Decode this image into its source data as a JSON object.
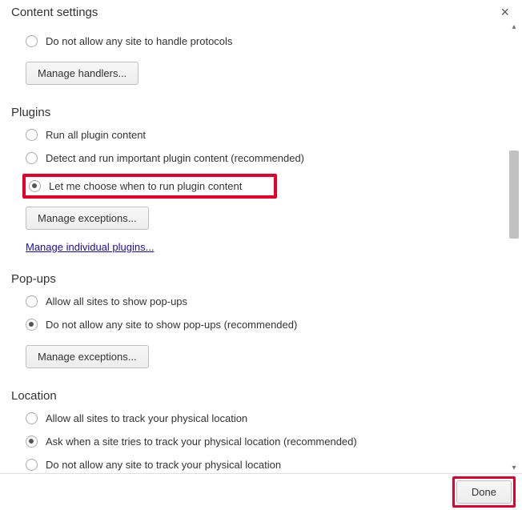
{
  "title": "Content settings",
  "handlers": {
    "opt_block": "Do not allow any site to handle protocols",
    "manage_btn": "Manage handlers..."
  },
  "plugins": {
    "heading": "Plugins",
    "opt_run_all": "Run all plugin content",
    "opt_detect": "Detect and run important plugin content (recommended)",
    "opt_choose": "Let me choose when to run plugin content",
    "manage_exceptions": "Manage exceptions...",
    "manage_individual": "Manage individual plugins..."
  },
  "popups": {
    "heading": "Pop-ups",
    "opt_allow": "Allow all sites to show pop-ups",
    "opt_block": "Do not allow any site to show pop-ups (recommended)",
    "manage_exceptions": "Manage exceptions..."
  },
  "location": {
    "heading": "Location",
    "opt_allow": "Allow all sites to track your physical location",
    "opt_ask": "Ask when a site tries to track your physical location (recommended)",
    "opt_block": "Do not allow any site to track your physical location"
  },
  "done": "Done"
}
